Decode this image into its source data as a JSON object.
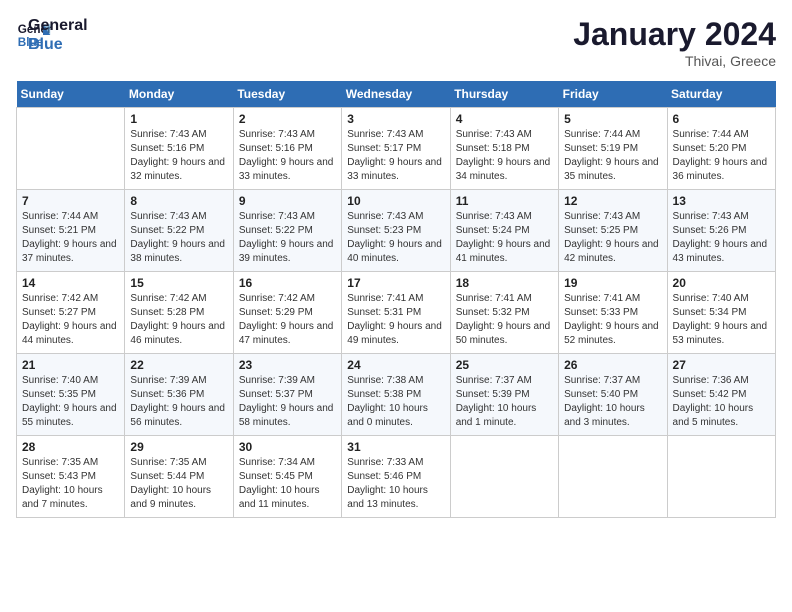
{
  "logo": {
    "line1": "General",
    "line2": "Blue"
  },
  "title": "January 2024",
  "location": "Thivai, Greece",
  "weekdays": [
    "Sunday",
    "Monday",
    "Tuesday",
    "Wednesday",
    "Thursday",
    "Friday",
    "Saturday"
  ],
  "weeks": [
    [
      {
        "day": "",
        "sunrise": "",
        "sunset": "",
        "daylight": ""
      },
      {
        "day": "1",
        "sunrise": "Sunrise: 7:43 AM",
        "sunset": "Sunset: 5:16 PM",
        "daylight": "Daylight: 9 hours and 32 minutes."
      },
      {
        "day": "2",
        "sunrise": "Sunrise: 7:43 AM",
        "sunset": "Sunset: 5:16 PM",
        "daylight": "Daylight: 9 hours and 33 minutes."
      },
      {
        "day": "3",
        "sunrise": "Sunrise: 7:43 AM",
        "sunset": "Sunset: 5:17 PM",
        "daylight": "Daylight: 9 hours and 33 minutes."
      },
      {
        "day": "4",
        "sunrise": "Sunrise: 7:43 AM",
        "sunset": "Sunset: 5:18 PM",
        "daylight": "Daylight: 9 hours and 34 minutes."
      },
      {
        "day": "5",
        "sunrise": "Sunrise: 7:44 AM",
        "sunset": "Sunset: 5:19 PM",
        "daylight": "Daylight: 9 hours and 35 minutes."
      },
      {
        "day": "6",
        "sunrise": "Sunrise: 7:44 AM",
        "sunset": "Sunset: 5:20 PM",
        "daylight": "Daylight: 9 hours and 36 minutes."
      }
    ],
    [
      {
        "day": "7",
        "sunrise": "Sunrise: 7:44 AM",
        "sunset": "Sunset: 5:21 PM",
        "daylight": "Daylight: 9 hours and 37 minutes."
      },
      {
        "day": "8",
        "sunrise": "Sunrise: 7:43 AM",
        "sunset": "Sunset: 5:22 PM",
        "daylight": "Daylight: 9 hours and 38 minutes."
      },
      {
        "day": "9",
        "sunrise": "Sunrise: 7:43 AM",
        "sunset": "Sunset: 5:22 PM",
        "daylight": "Daylight: 9 hours and 39 minutes."
      },
      {
        "day": "10",
        "sunrise": "Sunrise: 7:43 AM",
        "sunset": "Sunset: 5:23 PM",
        "daylight": "Daylight: 9 hours and 40 minutes."
      },
      {
        "day": "11",
        "sunrise": "Sunrise: 7:43 AM",
        "sunset": "Sunset: 5:24 PM",
        "daylight": "Daylight: 9 hours and 41 minutes."
      },
      {
        "day": "12",
        "sunrise": "Sunrise: 7:43 AM",
        "sunset": "Sunset: 5:25 PM",
        "daylight": "Daylight: 9 hours and 42 minutes."
      },
      {
        "day": "13",
        "sunrise": "Sunrise: 7:43 AM",
        "sunset": "Sunset: 5:26 PM",
        "daylight": "Daylight: 9 hours and 43 minutes."
      }
    ],
    [
      {
        "day": "14",
        "sunrise": "Sunrise: 7:42 AM",
        "sunset": "Sunset: 5:27 PM",
        "daylight": "Daylight: 9 hours and 44 minutes."
      },
      {
        "day": "15",
        "sunrise": "Sunrise: 7:42 AM",
        "sunset": "Sunset: 5:28 PM",
        "daylight": "Daylight: 9 hours and 46 minutes."
      },
      {
        "day": "16",
        "sunrise": "Sunrise: 7:42 AM",
        "sunset": "Sunset: 5:29 PM",
        "daylight": "Daylight: 9 hours and 47 minutes."
      },
      {
        "day": "17",
        "sunrise": "Sunrise: 7:41 AM",
        "sunset": "Sunset: 5:31 PM",
        "daylight": "Daylight: 9 hours and 49 minutes."
      },
      {
        "day": "18",
        "sunrise": "Sunrise: 7:41 AM",
        "sunset": "Sunset: 5:32 PM",
        "daylight": "Daylight: 9 hours and 50 minutes."
      },
      {
        "day": "19",
        "sunrise": "Sunrise: 7:41 AM",
        "sunset": "Sunset: 5:33 PM",
        "daylight": "Daylight: 9 hours and 52 minutes."
      },
      {
        "day": "20",
        "sunrise": "Sunrise: 7:40 AM",
        "sunset": "Sunset: 5:34 PM",
        "daylight": "Daylight: 9 hours and 53 minutes."
      }
    ],
    [
      {
        "day": "21",
        "sunrise": "Sunrise: 7:40 AM",
        "sunset": "Sunset: 5:35 PM",
        "daylight": "Daylight: 9 hours and 55 minutes."
      },
      {
        "day": "22",
        "sunrise": "Sunrise: 7:39 AM",
        "sunset": "Sunset: 5:36 PM",
        "daylight": "Daylight: 9 hours and 56 minutes."
      },
      {
        "day": "23",
        "sunrise": "Sunrise: 7:39 AM",
        "sunset": "Sunset: 5:37 PM",
        "daylight": "Daylight: 9 hours and 58 minutes."
      },
      {
        "day": "24",
        "sunrise": "Sunrise: 7:38 AM",
        "sunset": "Sunset: 5:38 PM",
        "daylight": "Daylight: 10 hours and 0 minutes."
      },
      {
        "day": "25",
        "sunrise": "Sunrise: 7:37 AM",
        "sunset": "Sunset: 5:39 PM",
        "daylight": "Daylight: 10 hours and 1 minute."
      },
      {
        "day": "26",
        "sunrise": "Sunrise: 7:37 AM",
        "sunset": "Sunset: 5:40 PM",
        "daylight": "Daylight: 10 hours and 3 minutes."
      },
      {
        "day": "27",
        "sunrise": "Sunrise: 7:36 AM",
        "sunset": "Sunset: 5:42 PM",
        "daylight": "Daylight: 10 hours and 5 minutes."
      }
    ],
    [
      {
        "day": "28",
        "sunrise": "Sunrise: 7:35 AM",
        "sunset": "Sunset: 5:43 PM",
        "daylight": "Daylight: 10 hours and 7 minutes."
      },
      {
        "day": "29",
        "sunrise": "Sunrise: 7:35 AM",
        "sunset": "Sunset: 5:44 PM",
        "daylight": "Daylight: 10 hours and 9 minutes."
      },
      {
        "day": "30",
        "sunrise": "Sunrise: 7:34 AM",
        "sunset": "Sunset: 5:45 PM",
        "daylight": "Daylight: 10 hours and 11 minutes."
      },
      {
        "day": "31",
        "sunrise": "Sunrise: 7:33 AM",
        "sunset": "Sunset: 5:46 PM",
        "daylight": "Daylight: 10 hours and 13 minutes."
      },
      {
        "day": "",
        "sunrise": "",
        "sunset": "",
        "daylight": ""
      },
      {
        "day": "",
        "sunrise": "",
        "sunset": "",
        "daylight": ""
      },
      {
        "day": "",
        "sunrise": "",
        "sunset": "",
        "daylight": ""
      }
    ]
  ]
}
